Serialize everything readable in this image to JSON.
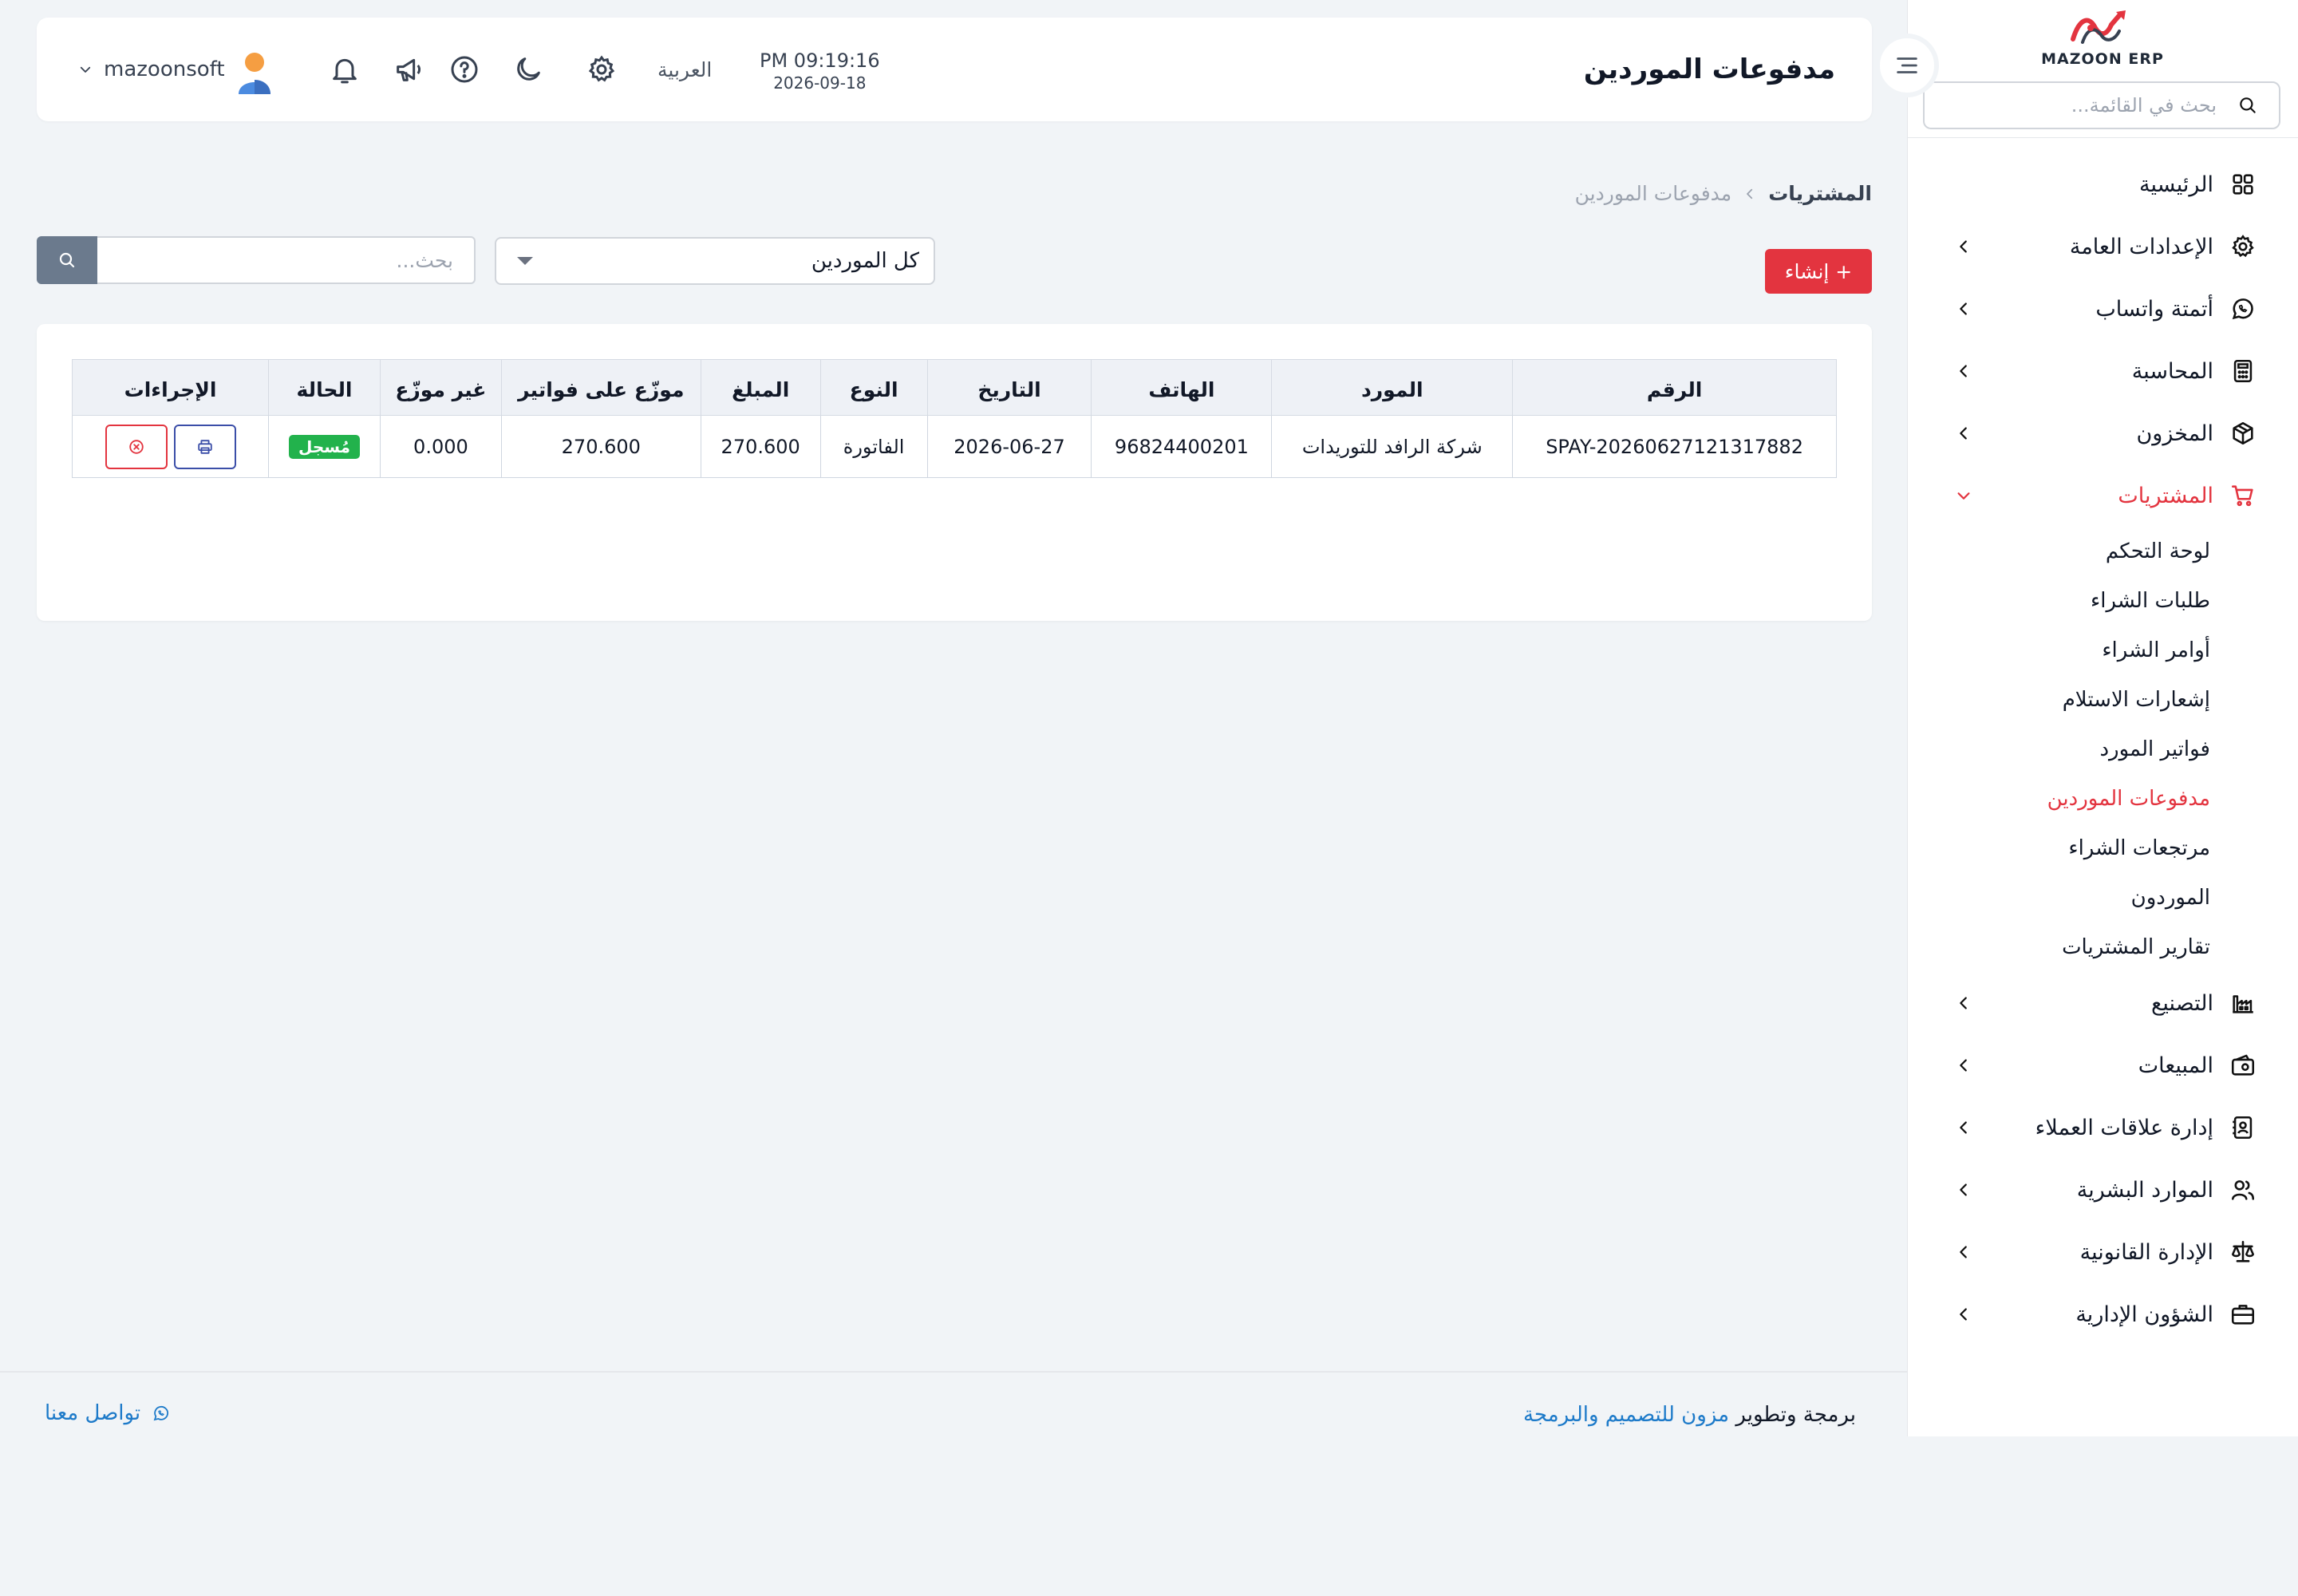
{
  "app": {
    "logo_small": "ERPجود",
    "logo_text": "MAZOON ERP",
    "accent": "#e3343f",
    "link_color": "#1d7ac9"
  },
  "sidebar": {
    "search_placeholder": "بحث في القائمة...",
    "items": [
      {
        "label": "الرئيسية",
        "icon": "grid-icon",
        "chevron": false
      },
      {
        "label": "الإعدادات العامة",
        "icon": "gear-icon",
        "chevron": true
      },
      {
        "label": "أتمتة واتساب",
        "icon": "whatsapp-icon",
        "chevron": true
      },
      {
        "label": "المحاسبة",
        "icon": "calculator-icon",
        "chevron": true
      },
      {
        "label": "المخزون",
        "icon": "box-icon",
        "chevron": true
      },
      {
        "label": "المشتريات",
        "icon": "cart-icon",
        "chevron": true,
        "active": true
      }
    ],
    "purchases_sub": [
      {
        "label": "لوحة التحكم"
      },
      {
        "label": "طلبات الشراء"
      },
      {
        "label": "أوامر الشراء"
      },
      {
        "label": "إشعارات الاستلام"
      },
      {
        "label": "فواتير المورد"
      },
      {
        "label": "مدفوعات الموردين",
        "active": true
      },
      {
        "label": "مرتجعات الشراء"
      },
      {
        "label": "الموردون"
      },
      {
        "label": "تقارير المشتريات"
      }
    ],
    "items_after": [
      {
        "label": "التصنيع",
        "icon": "factory-icon"
      },
      {
        "label": "المبيعات",
        "icon": "wallet-icon"
      },
      {
        "label": "إدارة علاقات العملاء",
        "icon": "contacts-icon"
      },
      {
        "label": "الموارد البشرية",
        "icon": "users-icon"
      },
      {
        "label": "الإدارة القانونية",
        "icon": "scale-icon"
      },
      {
        "label": "الشؤون الإدارية",
        "icon": "briefcase-icon"
      }
    ]
  },
  "header": {
    "title": "مدفوعات الموردين",
    "username": "mazoonsoft",
    "language": "العربية",
    "time": "PM 09:19:16",
    "date": "2026-09-18"
  },
  "breadcrumb": {
    "parent": "المشتريات",
    "current": "مدفوعات الموردين"
  },
  "toolbar": {
    "create_label": "+ إنشاء",
    "supplier_filter": "كل الموردين",
    "search_placeholder": "بحث..."
  },
  "table": {
    "columns": [
      "الرقم",
      "المورد",
      "الهاتف",
      "التاريخ",
      "النوع",
      "المبلغ",
      "موزّع على فواتير",
      "غير موزّع",
      "الحالة",
      "الإجراءات"
    ],
    "rows": [
      {
        "number": "SPAY-20260627121317882",
        "supplier": "شركة الرافد للتوريدات",
        "phone": "96824400201",
        "date": "2026-06-27",
        "type": "الفاتورة",
        "amount": "270.600",
        "allocated": "270.600",
        "unallocated": "0.000",
        "status": "مُسجل"
      }
    ]
  },
  "footer": {
    "prefix": "برمجة وتطوير",
    "company": "مزون للتصميم والبرمجة",
    "contact": "تواصل معنا"
  }
}
